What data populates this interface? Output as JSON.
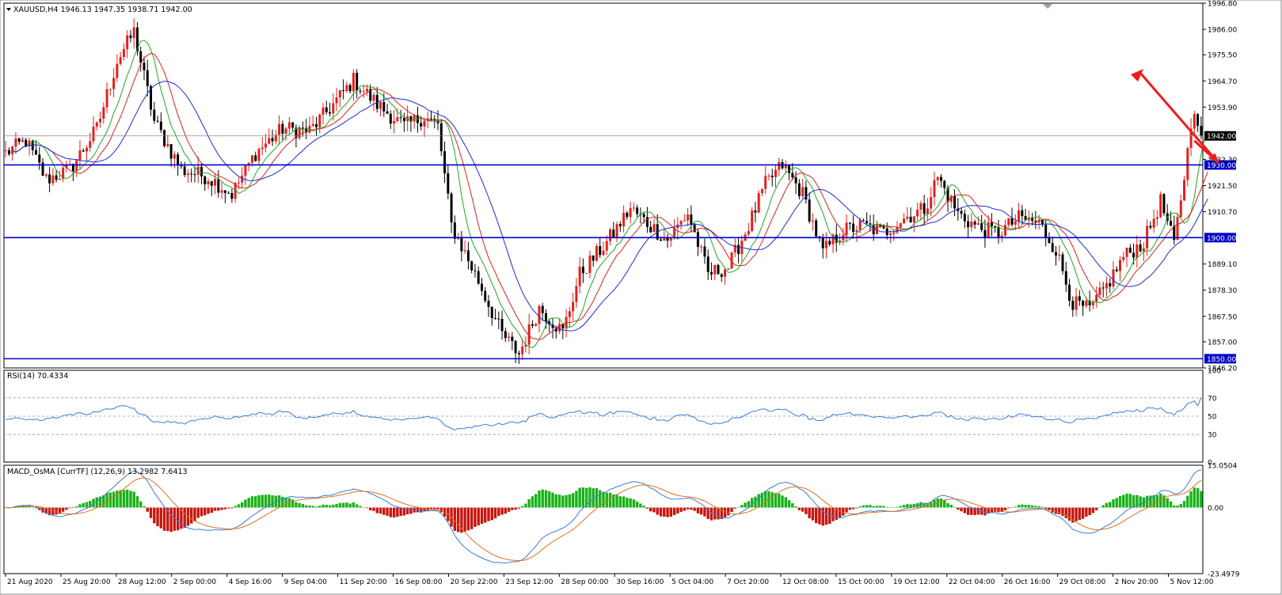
{
  "symbol_header": "XAUUSD,H4",
  "ohlc": "1946.13 1947.35 1938.71 1942.00",
  "colors": {
    "bull": "#e3201b",
    "bear": "#000000",
    "ma_fast": "#1faa1f",
    "ma_mid": "#e3201b",
    "ma_slow": "#1d2bd6",
    "level": "#0000cc",
    "rsi": "#3c7bd6",
    "hist_pos": "#19b219",
    "hist_neg": "#c8160f",
    "macd_line": "#3c7bd6",
    "signal_line": "#e07020",
    "arrow": "#ee1c1c"
  },
  "chart_data": [
    {
      "type": "candlestick",
      "pane": "price",
      "symbol": "XAUUSD",
      "timeframe": "H4",
      "current_price": 1942.0,
      "ylim": [
        1846.2,
        1996.8
      ],
      "y_ticks": [
        "1996.80",
        "1986.00",
        "1975.50",
        "1964.70",
        "1953.90",
        "1942.00",
        "1932.30",
        "1921.50",
        "1910.70",
        "1900.00",
        "1889.10",
        "1878.30",
        "1867.50",
        "1857.00",
        "1850.00",
        "1846.20"
      ],
      "x_ticks": [
        "21 Aug 2020",
        "25 Aug 20:00",
        "28 Aug 12:00",
        "2 Sep 00:00",
        "4 Sep 16:00",
        "9 Sep 04:00",
        "11 Sep 20:00",
        "16 Sep 08:00",
        "20 Sep 22:00",
        "23 Sep 12:00",
        "28 Sep 00:00",
        "30 Sep 16:00",
        "5 Oct 04:00",
        "7 Oct 20:00",
        "12 Oct 08:00",
        "15 Oct 00:00",
        "19 Oct 12:00",
        "22 Oct 04:00",
        "26 Oct 16:00",
        "29 Oct 08:00",
        "2 Nov 20:00",
        "5 Nov 12:00"
      ],
      "anchors": [
        [
          0,
          1935
        ],
        [
          6,
          1940
        ],
        [
          12,
          1924
        ],
        [
          19,
          1928
        ],
        [
          27,
          1945
        ],
        [
          33,
          1973
        ],
        [
          38,
          1985
        ],
        [
          44,
          1948
        ],
        [
          52,
          1928
        ],
        [
          60,
          1925
        ],
        [
          67,
          1918
        ],
        [
          74,
          1935
        ],
        [
          82,
          1945
        ],
        [
          90,
          1944
        ],
        [
          97,
          1955
        ],
        [
          103,
          1965
        ],
        [
          110,
          1955
        ],
        [
          118,
          1946
        ],
        [
          124,
          1950
        ],
        [
          128,
          1946
        ],
        [
          132,
          1905
        ],
        [
          140,
          1882
        ],
        [
          147,
          1860
        ],
        [
          152,
          1852
        ],
        [
          158,
          1871
        ],
        [
          165,
          1861
        ],
        [
          170,
          1885
        ],
        [
          178,
          1898
        ],
        [
          185,
          1912
        ],
        [
          190,
          1906
        ],
        [
          196,
          1899
        ],
        [
          202,
          1910
        ],
        [
          208,
          1885
        ],
        [
          214,
          1888
        ],
        [
          220,
          1905
        ],
        [
          225,
          1922
        ],
        [
          230,
          1930
        ],
        [
          236,
          1918
        ],
        [
          242,
          1894
        ],
        [
          248,
          1903
        ],
        [
          254,
          1905
        ],
        [
          260,
          1902
        ],
        [
          266,
          1908
        ],
        [
          272,
          1912
        ],
        [
          276,
          1925
        ],
        [
          282,
          1910
        ],
        [
          288,
          1904
        ],
        [
          294,
          1902
        ],
        [
          300,
          1908
        ],
        [
          306,
          1906
        ],
        [
          311,
          1895
        ],
        [
          316,
          1873
        ],
        [
          321,
          1870
        ],
        [
          326,
          1880
        ],
        [
          331,
          1892
        ],
        [
          337,
          1898
        ],
        [
          342,
          1915
        ],
        [
          346,
          1897
        ],
        [
          351,
          1945
        ],
        [
          353,
          1942
        ]
      ],
      "horizontal_levels": [
        1930.0,
        1900.0,
        1850.0
      ],
      "moving_averages": [
        "fast",
        "mid",
        "slow"
      ],
      "annotation": "red arrow: pullback to 1930.00 then continuation up"
    },
    {
      "type": "line",
      "pane": "rsi",
      "title": "RSI(14) 70.4334",
      "ylim": [
        0,
        100
      ],
      "y_ticks": [
        "100",
        "70",
        "50",
        "30",
        "0"
      ],
      "levels": [
        70,
        50,
        30
      ],
      "last_value": 70.4334
    },
    {
      "type": "histogram+line",
      "pane": "macd",
      "title": "MACD_OsMA [CurrTF] (12,26,9) 13.2982 7.6413",
      "ylim": [
        -23.4979,
        15.0504
      ],
      "y_ticks": [
        "15.0504",
        "0.00",
        "-23.4979"
      ],
      "macd": 13.2982,
      "signal": 7.6413
    }
  ]
}
